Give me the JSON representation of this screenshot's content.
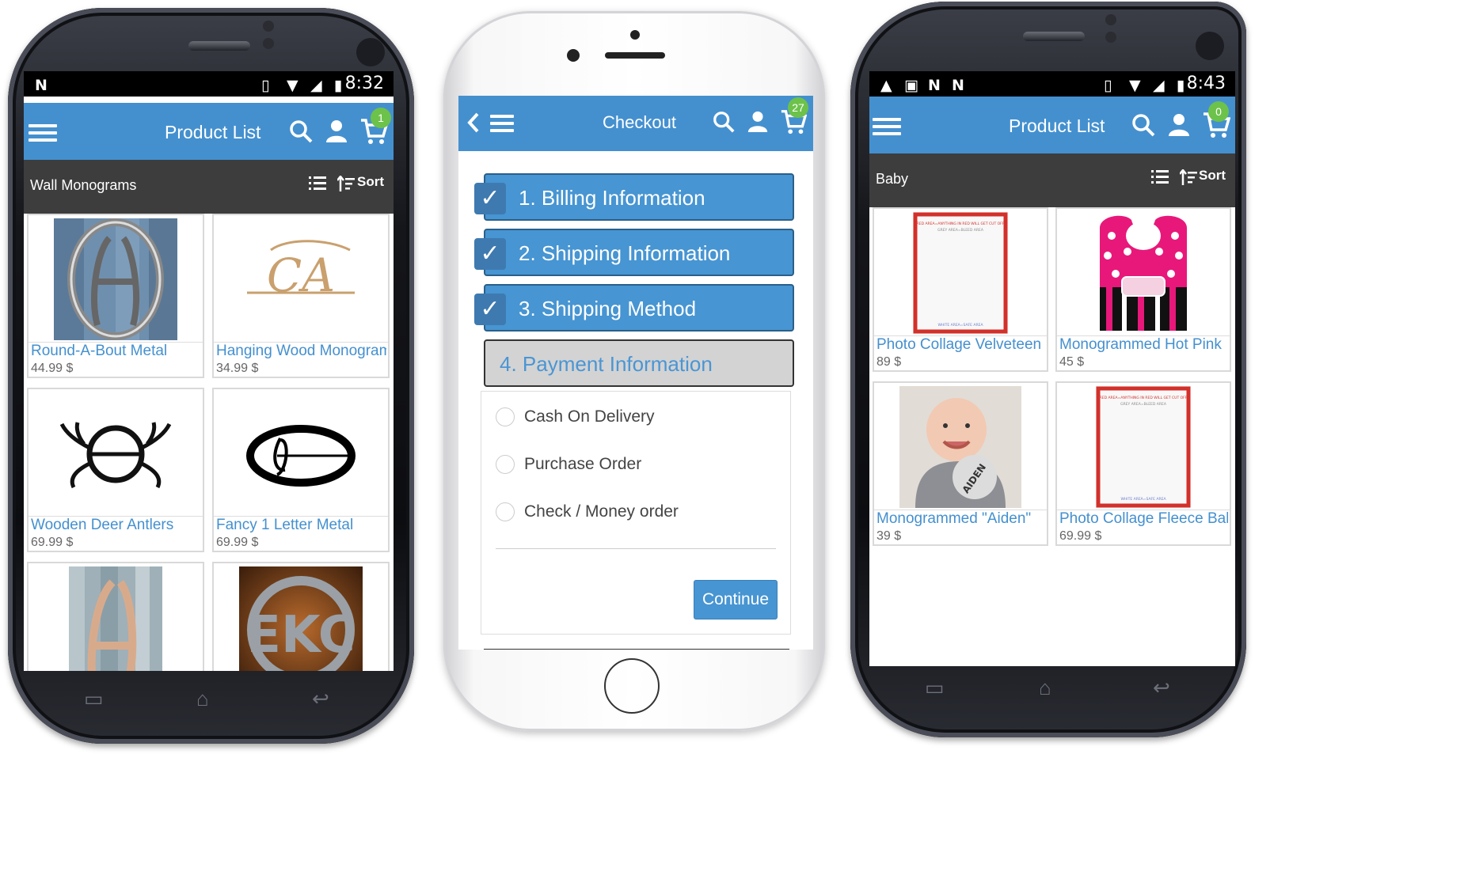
{
  "left_phone": {
    "status": {
      "time": "8:32"
    },
    "header": {
      "title": "Product List",
      "cart_count": "1"
    },
    "category": {
      "name": "Wall Monograms",
      "sort_label": "Sort"
    },
    "products": [
      {
        "name": "Round-A-Bout Metal",
        "price": "44.99 $"
      },
      {
        "name": "Hanging Wood Monogram",
        "price": "34.99 $"
      },
      {
        "name": "Wooden Deer Antlers",
        "price": "69.99 $"
      },
      {
        "name": "Fancy 1 Letter Metal",
        "price": "69.99 $"
      },
      {
        "name": "",
        "price": ""
      },
      {
        "name": "",
        "price": ""
      }
    ],
    "monogram_letters": {
      "hanging": "CA",
      "metal_ekc": "EKC"
    }
  },
  "checkout_phone": {
    "header": {
      "title": "Checkout",
      "cart_count": "27"
    },
    "steps": [
      {
        "label": "1. Billing Information",
        "completed": true
      },
      {
        "label": "2. Shipping Information",
        "completed": true
      },
      {
        "label": "3. Shipping Method",
        "completed": true
      },
      {
        "label": "4. Payment Information",
        "completed": false
      }
    ],
    "payment_options": [
      {
        "label": "Cash On Delivery"
      },
      {
        "label": "Purchase Order"
      },
      {
        "label": "Check / Money order"
      }
    ],
    "continue_label": "Continue"
  },
  "right_phone": {
    "status": {
      "time": "8:43"
    },
    "header": {
      "title": "Product List",
      "cart_count": "0"
    },
    "category": {
      "name": "Baby",
      "sort_label": "Sort"
    },
    "products": [
      {
        "name": "Photo Collage Velveteen",
        "price": "89 $"
      },
      {
        "name": "Monogrammed Hot Pink",
        "price": "45 $"
      },
      {
        "name": "Monogrammed \"Aiden\"",
        "price": "39 $"
      },
      {
        "name": "Photo Collage Fleece Baby",
        "price": "69.99 $"
      }
    ],
    "blanket_text": {
      "top": "RED AREA=ANYTHING IN RED WILL GET CUT OFF",
      "top2": "GREY AREA=BLEED AREA",
      "bottom": "WHITE AREA=SAFE AREA"
    },
    "bib_name": "AIDEN"
  },
  "colors": {
    "accent": "#4490cf",
    "badge": "#6cc24a",
    "category_bar": "#3d3d3d"
  }
}
